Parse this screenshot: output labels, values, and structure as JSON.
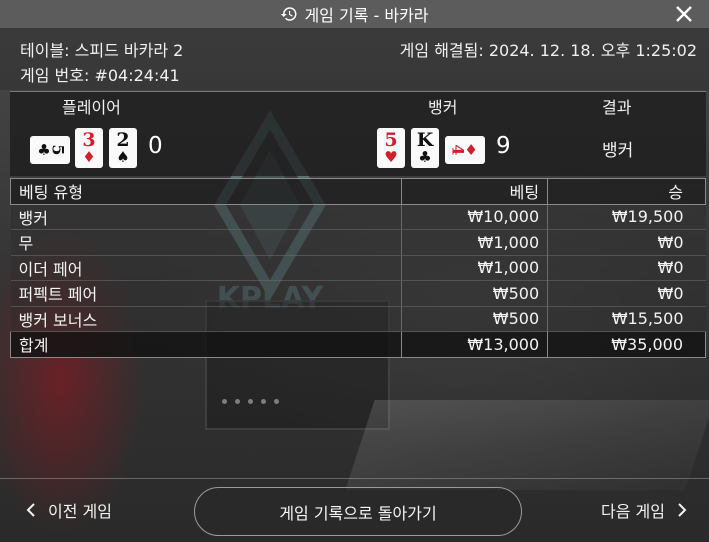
{
  "window": {
    "title": "게임 기록 - 바카라",
    "history_icon": "history-clock-icon",
    "close_icon": "close-icon"
  },
  "info": {
    "table_line": "테이블: 스피드 바카라 2",
    "resolved_line": "게임 해결됨: 2024. 12. 18. 오후 1:25:02",
    "game_number_line": "게임 번호: #04:24:41"
  },
  "hands": {
    "player_label": "플레이어",
    "banker_label": "뱅커",
    "result_label": "결과",
    "player_score": "0",
    "banker_score": "9",
    "result_value": "뱅커",
    "player_cards": [
      {
        "rank": "5",
        "suit": "♣",
        "color": "black",
        "orientation": "sideways"
      },
      {
        "rank": "3",
        "suit": "♦",
        "color": "red",
        "orientation": "upright"
      },
      {
        "rank": "2",
        "suit": "♠",
        "color": "black",
        "orientation": "upright"
      }
    ],
    "banker_cards": [
      {
        "rank": "5",
        "suit": "♥",
        "color": "red",
        "orientation": "upright"
      },
      {
        "rank": "K",
        "suit": "♣",
        "color": "black",
        "orientation": "upright"
      },
      {
        "rank": "4",
        "suit": "♦",
        "color": "red",
        "orientation": "sideways"
      }
    ]
  },
  "bets": {
    "headers": [
      "베팅 유형",
      "베팅",
      "승"
    ],
    "rows": [
      [
        "뱅커",
        "₩10,000",
        "₩19,500"
      ],
      [
        "무",
        "₩1,000",
        "₩0"
      ],
      [
        "이더 페어",
        "₩1,000",
        "₩0"
      ],
      [
        "퍼펙트 페어",
        "₩500",
        "₩0"
      ],
      [
        "뱅커 보너스",
        "₩500",
        "₩15,500"
      ]
    ],
    "total": [
      "합계",
      "₩13,000",
      "₩35,000"
    ]
  },
  "background": {
    "watermark_text": "KPLAY"
  },
  "footer": {
    "prev_label": "이전 게임",
    "back_label": "게임 기록으로 돌아가기",
    "next_label": "다음 게임"
  },
  "colors": {
    "title_bar": "#5c5c5c",
    "card_red": "#d21f2b",
    "card_black": "#111111",
    "text": "#f2f2f2"
  }
}
